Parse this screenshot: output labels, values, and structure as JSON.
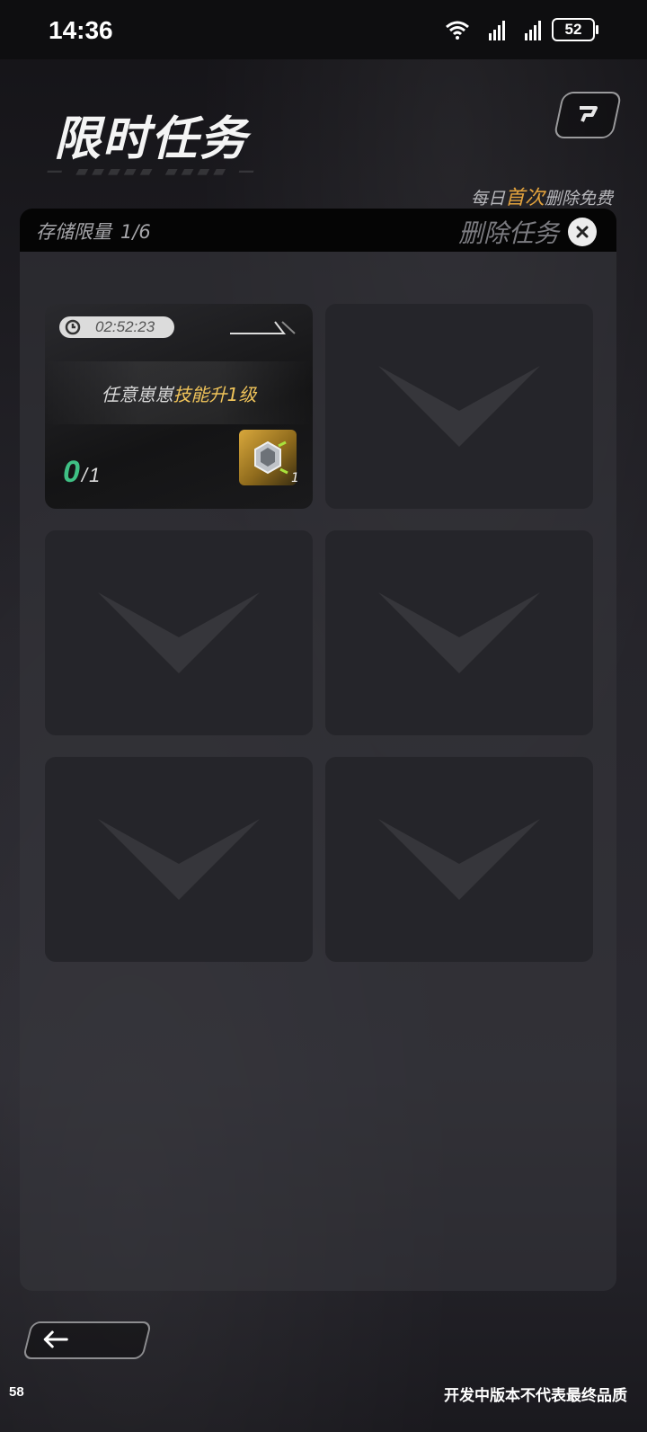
{
  "status_bar": {
    "time": "14:36",
    "battery": "52",
    "icons": [
      "wifi-icon",
      "signal-4g-icon",
      "signal-4g-icon"
    ]
  },
  "header": {
    "title": "限时任务",
    "free_note_prefix": "每日",
    "free_note_highlight": "首次",
    "free_note_suffix": "删除免费"
  },
  "panel": {
    "storage_label": "存储限量",
    "storage_value": "1/6",
    "delete_label": "删除任务"
  },
  "tasks": [
    {
      "timer": "02:52:23",
      "desc_plain": "任意崽崽",
      "desc_highlight": "技能升1级",
      "progress_current": "0",
      "progress_total": "1",
      "reward_icon": "gear-chip-icon",
      "reward_count": "1"
    }
  ],
  "footer": {
    "fps": "58",
    "dev_note": "开发中版本不代表最终品质"
  },
  "colors": {
    "accent_orange": "#e2a23d",
    "progress_green": "#3fc084",
    "highlight_gold": "#f0c45a"
  }
}
